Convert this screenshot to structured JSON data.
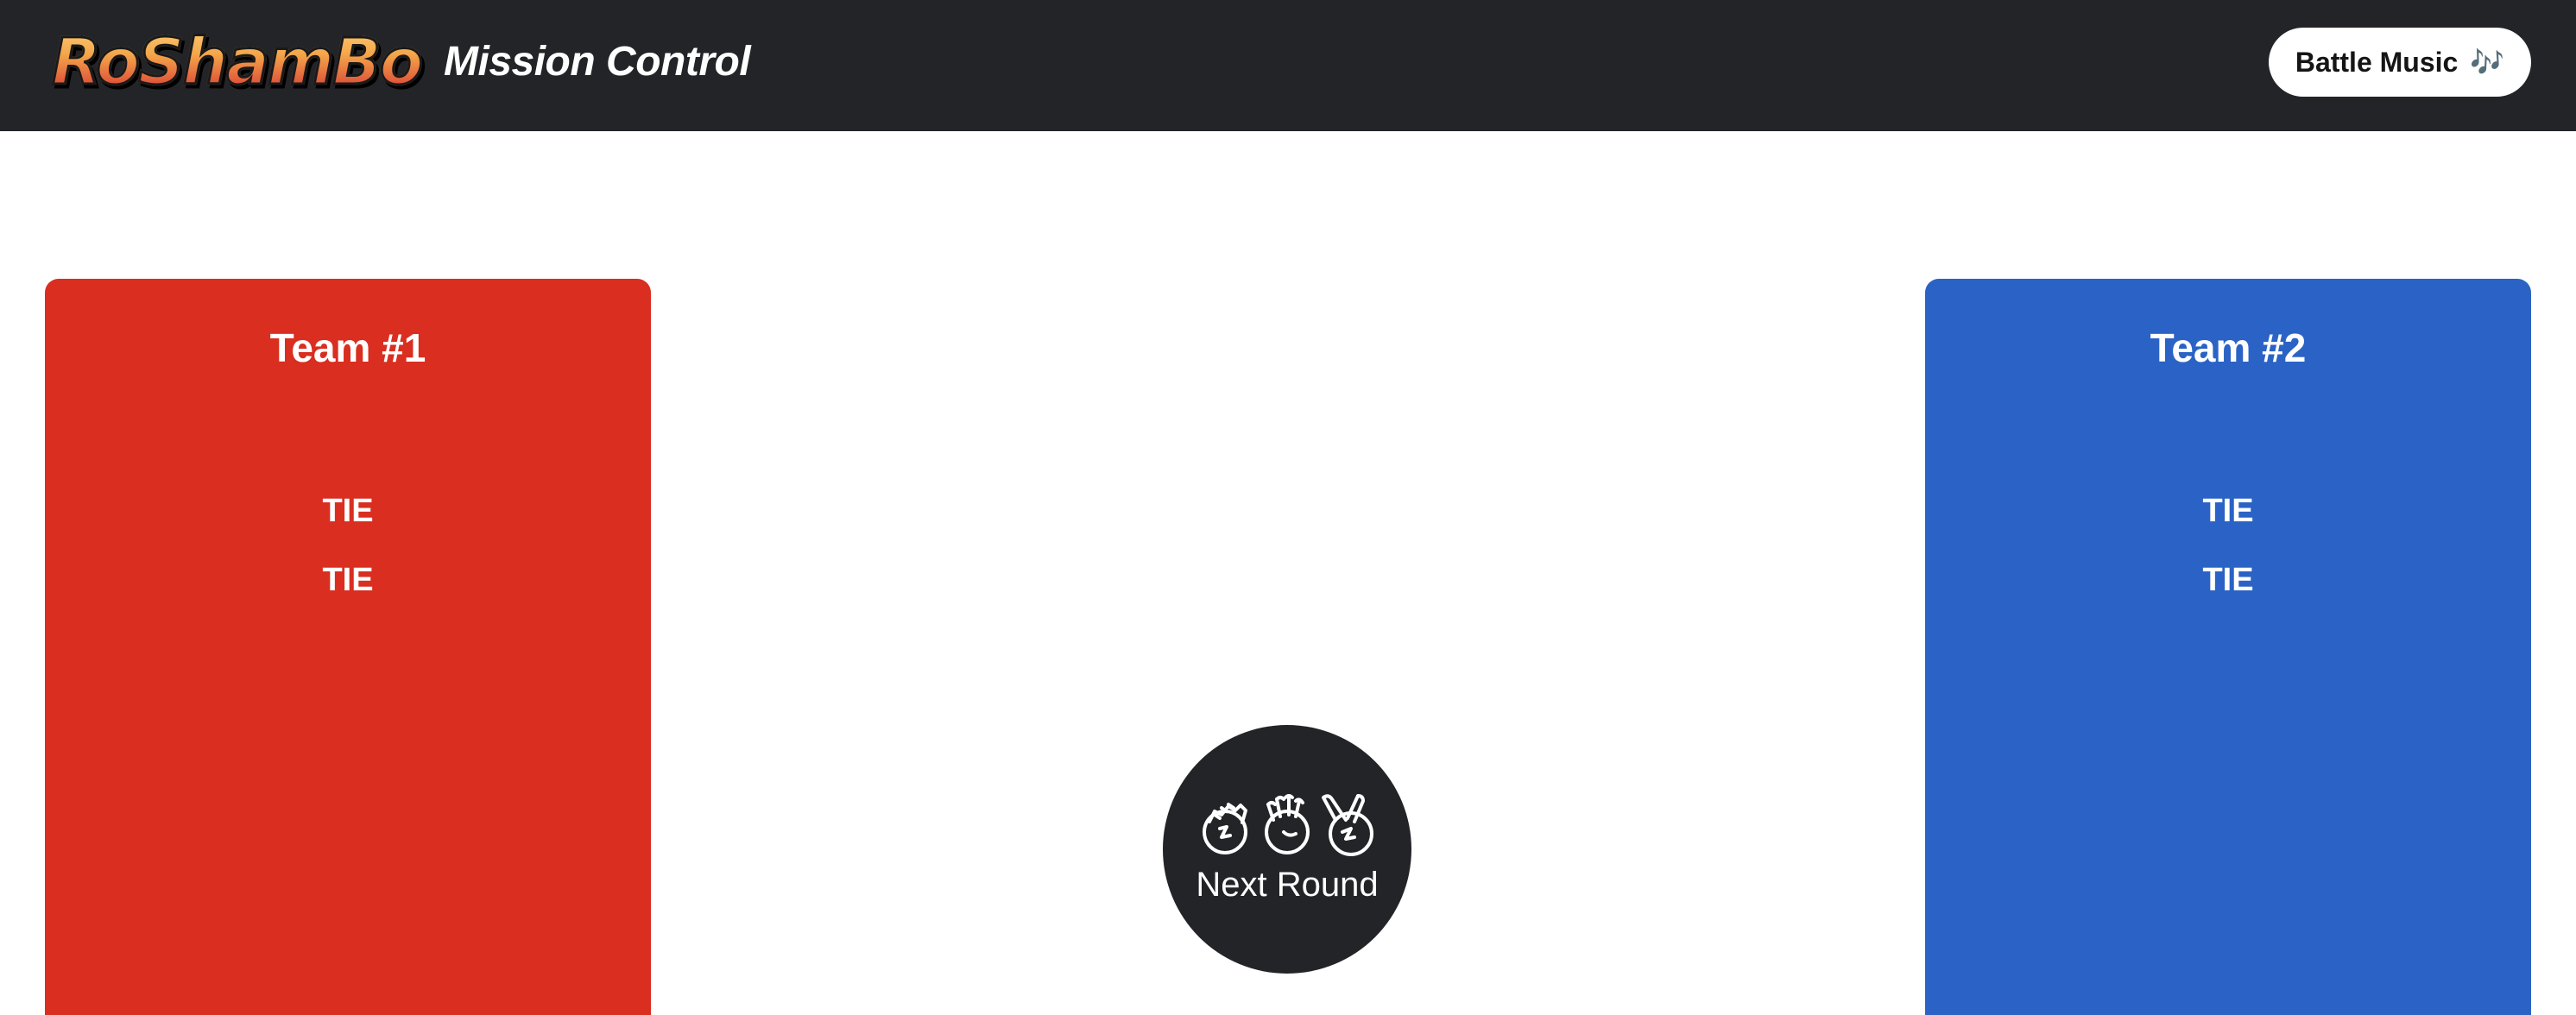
{
  "header": {
    "logo_text": "RoShamBo",
    "title": "Mission Control",
    "music_button": {
      "label": "Battle Music",
      "icon": "music-note-icon",
      "icon_glyph": "🎶"
    }
  },
  "teams": [
    {
      "name": "Team #1",
      "color": "#d92e20",
      "results": [
        "TIE",
        "TIE"
      ]
    },
    {
      "name": "Team #2",
      "color": "#2a63c5",
      "results": [
        "TIE",
        "TIE"
      ]
    }
  ],
  "next_round": {
    "label": "Next Round",
    "icons": [
      "rock-hand-icon",
      "paper-hand-icon",
      "scissors-hand-icon"
    ]
  },
  "colors": {
    "header_bg": "#232428",
    "page_bg": "#ffffff"
  }
}
